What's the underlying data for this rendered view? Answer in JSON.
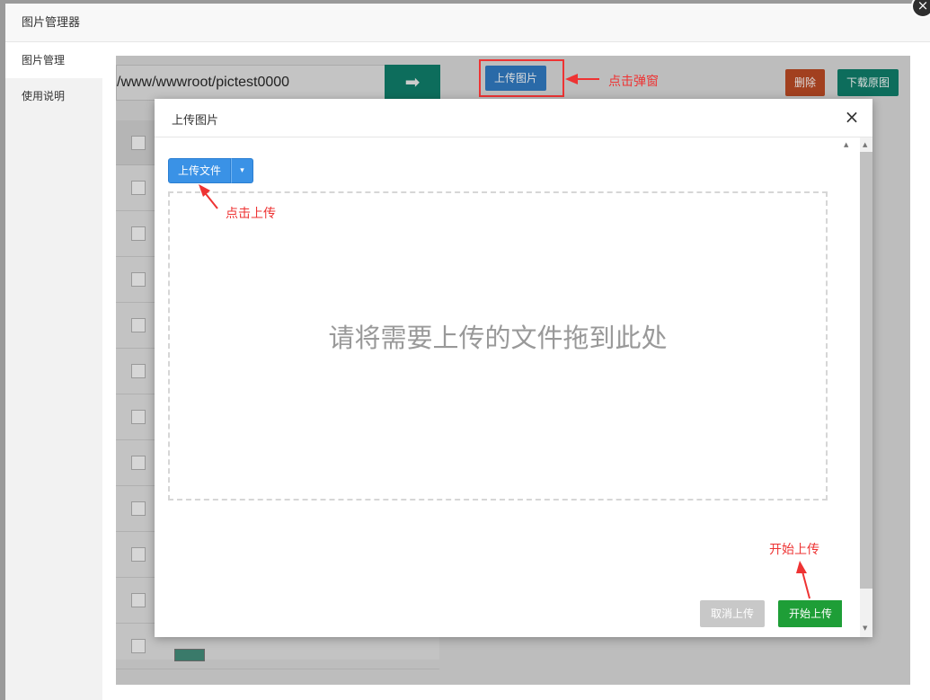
{
  "window": {
    "title": "图片管理器",
    "close_icon": "×"
  },
  "sidebar": {
    "items": [
      {
        "label": "图片管理"
      },
      {
        "label": "使用说明"
      }
    ]
  },
  "toolbar": {
    "path_value": "/www/wwwroot/pictest0000",
    "go_icon": "➡",
    "upload_image_label": "上传图片",
    "annotation_popup": "点击弹窗",
    "delete_label": "删除",
    "download_label": "下载原图"
  },
  "modal": {
    "title": "上传图片",
    "close_icon": "×",
    "upload_file_label": "上传文件",
    "dropdown_icon": "▾",
    "drop_hint": "请将需要上传的文件拖到此处",
    "annotation_click_upload": "点击上传",
    "annotation_start_upload": "开始上传",
    "cancel_label": "取消上传",
    "start_label": "开始上传"
  },
  "colors": {
    "annotation": "#ee3333",
    "primary": "#3a92e6",
    "success": "#1e9e37",
    "danger": "#a2401f",
    "teal": "#0d6d5c"
  }
}
